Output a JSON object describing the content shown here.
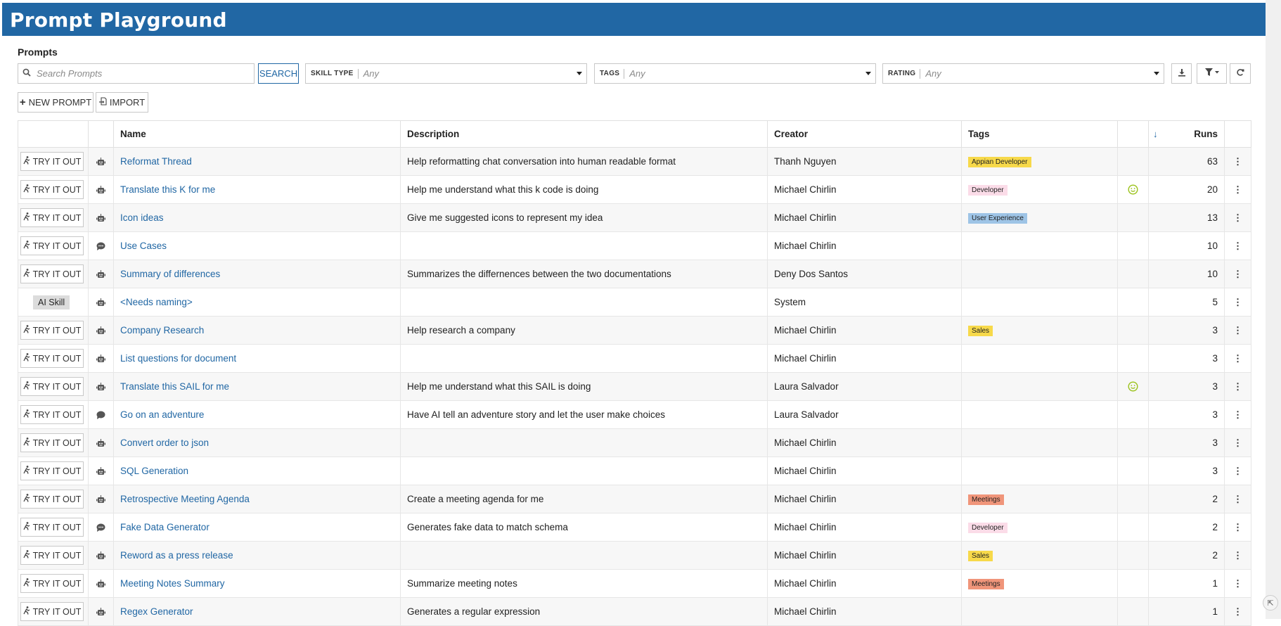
{
  "app": {
    "title": "Prompt Playground"
  },
  "section": {
    "label": "Prompts"
  },
  "search": {
    "placeholder": "Search Prompts",
    "button_label": "SEARCH"
  },
  "filters": {
    "skill_type": {
      "label": "SKILL TYPE",
      "value": "Any"
    },
    "tags": {
      "label": "TAGS",
      "value": "Any"
    },
    "rating": {
      "label": "RATING",
      "value": "Any"
    }
  },
  "toolbar": {
    "download_icon": "download-icon",
    "filter_icon": "filter-icon",
    "refresh_icon": "refresh-icon"
  },
  "actions": {
    "new_prompt": "NEW PROMPT",
    "import": "IMPORT"
  },
  "table": {
    "headers": {
      "name": "Name",
      "description": "Description",
      "creator": "Creator",
      "tags": "Tags",
      "runs": "Runs"
    },
    "sort": {
      "column": "runs",
      "direction": "descending"
    },
    "try_label": "TRY IT OUT",
    "rows": [
      {
        "action": "try",
        "type_icon": "robot-icon",
        "name": "Reformat Thread",
        "description": "Help reformatting chat conversation into human readable format",
        "creator": "Thanh Nguyen",
        "tag": "Appian Developer",
        "tag_color": "#f7d94a",
        "favorite": false,
        "runs": "63"
      },
      {
        "action": "try",
        "type_icon": "robot-icon",
        "name": "Translate this K for me",
        "description": "Help me understand what this k code is doing",
        "creator": "Michael Chirlin",
        "tag": "Developer",
        "tag_color": "#fbdce8",
        "favorite": true,
        "runs": "20"
      },
      {
        "action": "try",
        "type_icon": "robot-icon",
        "name": "Icon ideas",
        "description": "Give me suggested icons to represent my idea",
        "creator": "Michael Chirlin",
        "tag": "User Experience",
        "tag_color": "#9ec4e6",
        "favorite": false,
        "runs": "13"
      },
      {
        "action": "try",
        "type_icon": "chat-dots-icon",
        "name": "Use Cases",
        "description": "",
        "creator": "Michael Chirlin",
        "tag": "",
        "tag_color": "",
        "favorite": false,
        "runs": "10"
      },
      {
        "action": "try",
        "type_icon": "robot-icon",
        "name": "Summary of differences",
        "description": "Summarizes the differnences between the two documentations",
        "creator": "Deny Dos Santos",
        "tag": "",
        "tag_color": "",
        "favorite": false,
        "runs": "10"
      },
      {
        "action": "ai-skill",
        "action_label": "AI Skill",
        "type_icon": "robot-icon",
        "name": "<Needs naming>",
        "description": "",
        "creator": "System",
        "tag": "",
        "tag_color": "",
        "favorite": false,
        "runs": "5"
      },
      {
        "action": "try",
        "type_icon": "robot-icon",
        "name": "Company Research",
        "description": "Help research a company",
        "creator": "Michael Chirlin",
        "tag": "Sales",
        "tag_color": "#f7d94a",
        "favorite": false,
        "runs": "3"
      },
      {
        "action": "try",
        "type_icon": "robot-icon",
        "name": "List questions for document",
        "description": "",
        "creator": "Michael Chirlin",
        "tag": "",
        "tag_color": "",
        "favorite": false,
        "runs": "3"
      },
      {
        "action": "try",
        "type_icon": "robot-icon",
        "name": "Translate this SAIL for me",
        "description": "Help me understand what this SAIL is doing",
        "creator": "Laura Salvador",
        "tag": "",
        "tag_color": "",
        "favorite": true,
        "runs": "3"
      },
      {
        "action": "try",
        "type_icon": "chat-icon",
        "name": "Go on an adventure",
        "description": "Have AI tell an adventure story and let the user make choices",
        "creator": "Laura Salvador",
        "tag": "",
        "tag_color": "",
        "favorite": false,
        "runs": "3"
      },
      {
        "action": "try",
        "type_icon": "robot-icon",
        "name": "Convert order to json",
        "description": "",
        "creator": "Michael Chirlin",
        "tag": "",
        "tag_color": "",
        "favorite": false,
        "runs": "3"
      },
      {
        "action": "try",
        "type_icon": "robot-icon",
        "name": "SQL Generation",
        "description": "",
        "creator": "Michael Chirlin",
        "tag": "",
        "tag_color": "",
        "favorite": false,
        "runs": "3"
      },
      {
        "action": "try",
        "type_icon": "robot-icon",
        "name": "Retrospective Meeting Agenda",
        "description": "Create a meeting agenda for me",
        "creator": "Michael Chirlin",
        "tag": "Meetings",
        "tag_color": "#f0957a",
        "favorite": false,
        "runs": "2"
      },
      {
        "action": "try",
        "type_icon": "chat-dots-icon",
        "name": "Fake Data Generator",
        "description": "Generates fake data to match schema",
        "creator": "Michael Chirlin",
        "tag": "Developer",
        "tag_color": "#fbdce8",
        "favorite": false,
        "runs": "2"
      },
      {
        "action": "try",
        "type_icon": "robot-icon",
        "name": "Reword as a press release",
        "description": "",
        "creator": "Michael Chirlin",
        "tag": "Sales",
        "tag_color": "#f7d94a",
        "favorite": false,
        "runs": "2"
      },
      {
        "action": "try",
        "type_icon": "robot-icon",
        "name": "Meeting Notes Summary",
        "description": "Summarize meeting notes",
        "creator": "Michael Chirlin",
        "tag": "Meetings",
        "tag_color": "#f0957a",
        "favorite": false,
        "runs": "1"
      },
      {
        "action": "try",
        "type_icon": "robot-icon",
        "name": "Regex Generator",
        "description": "Generates a regular expression",
        "creator": "Michael Chirlin",
        "tag": "",
        "tag_color": "",
        "favorite": false,
        "runs": "1"
      }
    ]
  },
  "colors": {
    "header_bg": "#2167a4",
    "link": "#2167a4",
    "favorite": "#9ac21a"
  }
}
